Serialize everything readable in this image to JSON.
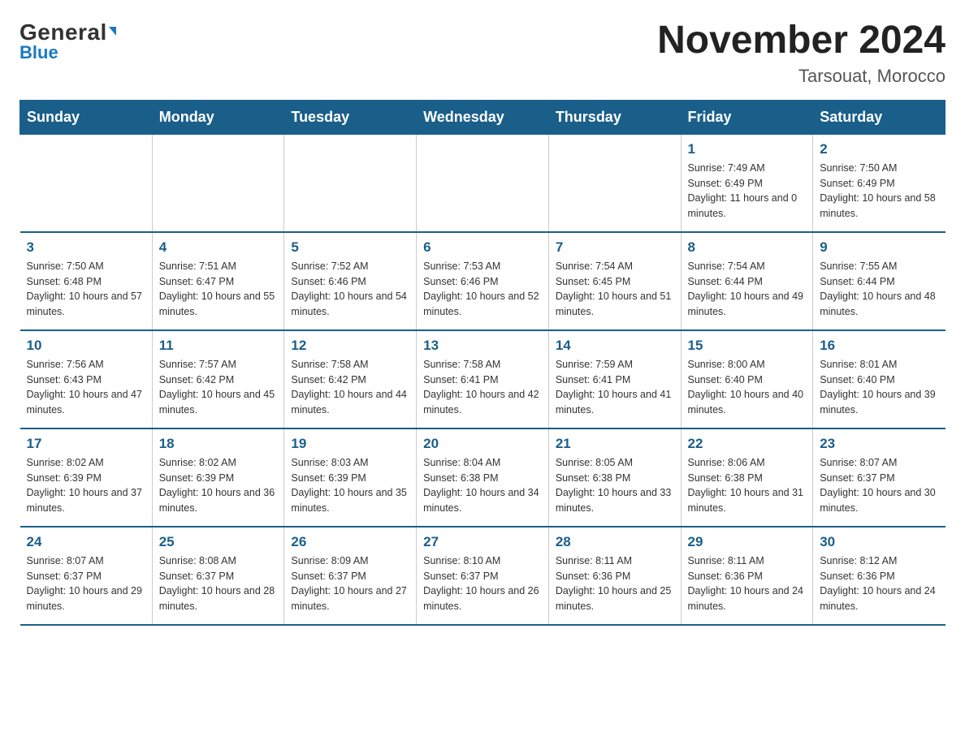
{
  "logo": {
    "general": "General",
    "arrow": "▼",
    "blue": "Blue"
  },
  "header": {
    "title": "November 2024",
    "subtitle": "Tarsouat, Morocco"
  },
  "weekdays": [
    "Sunday",
    "Monday",
    "Tuesday",
    "Wednesday",
    "Thursday",
    "Friday",
    "Saturday"
  ],
  "weeks": [
    [
      {
        "day": "",
        "info": ""
      },
      {
        "day": "",
        "info": ""
      },
      {
        "day": "",
        "info": ""
      },
      {
        "day": "",
        "info": ""
      },
      {
        "day": "",
        "info": ""
      },
      {
        "day": "1",
        "info": "Sunrise: 7:49 AM\nSunset: 6:49 PM\nDaylight: 11 hours and 0 minutes."
      },
      {
        "day": "2",
        "info": "Sunrise: 7:50 AM\nSunset: 6:49 PM\nDaylight: 10 hours and 58 minutes."
      }
    ],
    [
      {
        "day": "3",
        "info": "Sunrise: 7:50 AM\nSunset: 6:48 PM\nDaylight: 10 hours and 57 minutes."
      },
      {
        "day": "4",
        "info": "Sunrise: 7:51 AM\nSunset: 6:47 PM\nDaylight: 10 hours and 55 minutes."
      },
      {
        "day": "5",
        "info": "Sunrise: 7:52 AM\nSunset: 6:46 PM\nDaylight: 10 hours and 54 minutes."
      },
      {
        "day": "6",
        "info": "Sunrise: 7:53 AM\nSunset: 6:46 PM\nDaylight: 10 hours and 52 minutes."
      },
      {
        "day": "7",
        "info": "Sunrise: 7:54 AM\nSunset: 6:45 PM\nDaylight: 10 hours and 51 minutes."
      },
      {
        "day": "8",
        "info": "Sunrise: 7:54 AM\nSunset: 6:44 PM\nDaylight: 10 hours and 49 minutes."
      },
      {
        "day": "9",
        "info": "Sunrise: 7:55 AM\nSunset: 6:44 PM\nDaylight: 10 hours and 48 minutes."
      }
    ],
    [
      {
        "day": "10",
        "info": "Sunrise: 7:56 AM\nSunset: 6:43 PM\nDaylight: 10 hours and 47 minutes."
      },
      {
        "day": "11",
        "info": "Sunrise: 7:57 AM\nSunset: 6:42 PM\nDaylight: 10 hours and 45 minutes."
      },
      {
        "day": "12",
        "info": "Sunrise: 7:58 AM\nSunset: 6:42 PM\nDaylight: 10 hours and 44 minutes."
      },
      {
        "day": "13",
        "info": "Sunrise: 7:58 AM\nSunset: 6:41 PM\nDaylight: 10 hours and 42 minutes."
      },
      {
        "day": "14",
        "info": "Sunrise: 7:59 AM\nSunset: 6:41 PM\nDaylight: 10 hours and 41 minutes."
      },
      {
        "day": "15",
        "info": "Sunrise: 8:00 AM\nSunset: 6:40 PM\nDaylight: 10 hours and 40 minutes."
      },
      {
        "day": "16",
        "info": "Sunrise: 8:01 AM\nSunset: 6:40 PM\nDaylight: 10 hours and 39 minutes."
      }
    ],
    [
      {
        "day": "17",
        "info": "Sunrise: 8:02 AM\nSunset: 6:39 PM\nDaylight: 10 hours and 37 minutes."
      },
      {
        "day": "18",
        "info": "Sunrise: 8:02 AM\nSunset: 6:39 PM\nDaylight: 10 hours and 36 minutes."
      },
      {
        "day": "19",
        "info": "Sunrise: 8:03 AM\nSunset: 6:39 PM\nDaylight: 10 hours and 35 minutes."
      },
      {
        "day": "20",
        "info": "Sunrise: 8:04 AM\nSunset: 6:38 PM\nDaylight: 10 hours and 34 minutes."
      },
      {
        "day": "21",
        "info": "Sunrise: 8:05 AM\nSunset: 6:38 PM\nDaylight: 10 hours and 33 minutes."
      },
      {
        "day": "22",
        "info": "Sunrise: 8:06 AM\nSunset: 6:38 PM\nDaylight: 10 hours and 31 minutes."
      },
      {
        "day": "23",
        "info": "Sunrise: 8:07 AM\nSunset: 6:37 PM\nDaylight: 10 hours and 30 minutes."
      }
    ],
    [
      {
        "day": "24",
        "info": "Sunrise: 8:07 AM\nSunset: 6:37 PM\nDaylight: 10 hours and 29 minutes."
      },
      {
        "day": "25",
        "info": "Sunrise: 8:08 AM\nSunset: 6:37 PM\nDaylight: 10 hours and 28 minutes."
      },
      {
        "day": "26",
        "info": "Sunrise: 8:09 AM\nSunset: 6:37 PM\nDaylight: 10 hours and 27 minutes."
      },
      {
        "day": "27",
        "info": "Sunrise: 8:10 AM\nSunset: 6:37 PM\nDaylight: 10 hours and 26 minutes."
      },
      {
        "day": "28",
        "info": "Sunrise: 8:11 AM\nSunset: 6:36 PM\nDaylight: 10 hours and 25 minutes."
      },
      {
        "day": "29",
        "info": "Sunrise: 8:11 AM\nSunset: 6:36 PM\nDaylight: 10 hours and 24 minutes."
      },
      {
        "day": "30",
        "info": "Sunrise: 8:12 AM\nSunset: 6:36 PM\nDaylight: 10 hours and 24 minutes."
      }
    ]
  ]
}
